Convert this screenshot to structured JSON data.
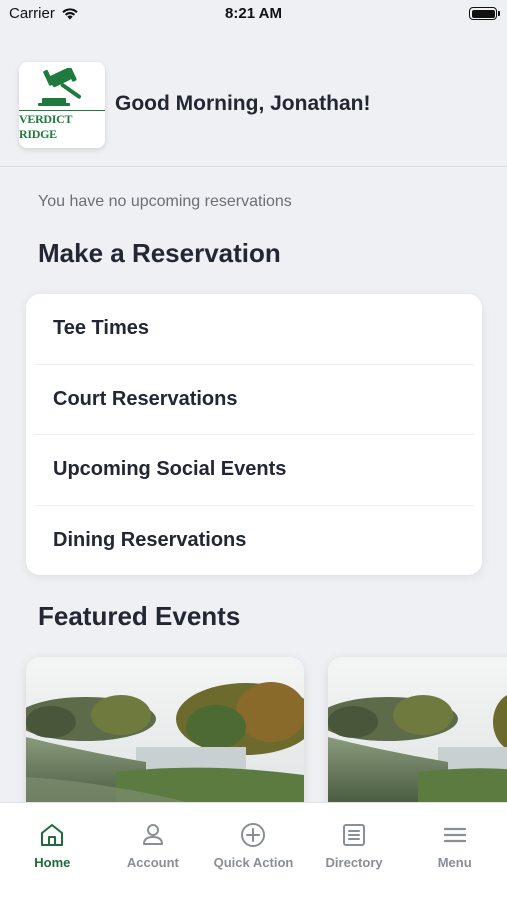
{
  "status_bar": {
    "carrier": "Carrier",
    "time": "8:21 AM",
    "icons": [
      "wifi-icon",
      "battery-icon"
    ]
  },
  "header": {
    "logo_text": "VERDICT RIDGE",
    "logo_icon": "gavel-icon",
    "greeting": "Good Morning, Jonathan!"
  },
  "reservations": {
    "empty_message": "You have no upcoming reservations",
    "title": "Make a Reservation",
    "items": [
      {
        "label": "Tee Times"
      },
      {
        "label": "Court Reservations"
      },
      {
        "label": "Upcoming Social Events"
      },
      {
        "label": "Dining Reservations"
      }
    ]
  },
  "featured": {
    "title": "Featured Events"
  },
  "tab_bar": {
    "items": [
      {
        "label": "Home",
        "icon": "home-icon",
        "active": true
      },
      {
        "label": "Account",
        "icon": "person-icon",
        "active": false
      },
      {
        "label": "Quick Action",
        "icon": "plus-circle-icon",
        "active": false
      },
      {
        "label": "Directory",
        "icon": "list-icon",
        "active": false
      },
      {
        "label": "Menu",
        "icon": "hamburger-icon",
        "active": false
      }
    ]
  },
  "colors": {
    "background": "#eff0f4",
    "brand_green": "#1f6b3b",
    "inactive_tab": "#8a8e96",
    "text_primary": "#222733"
  }
}
